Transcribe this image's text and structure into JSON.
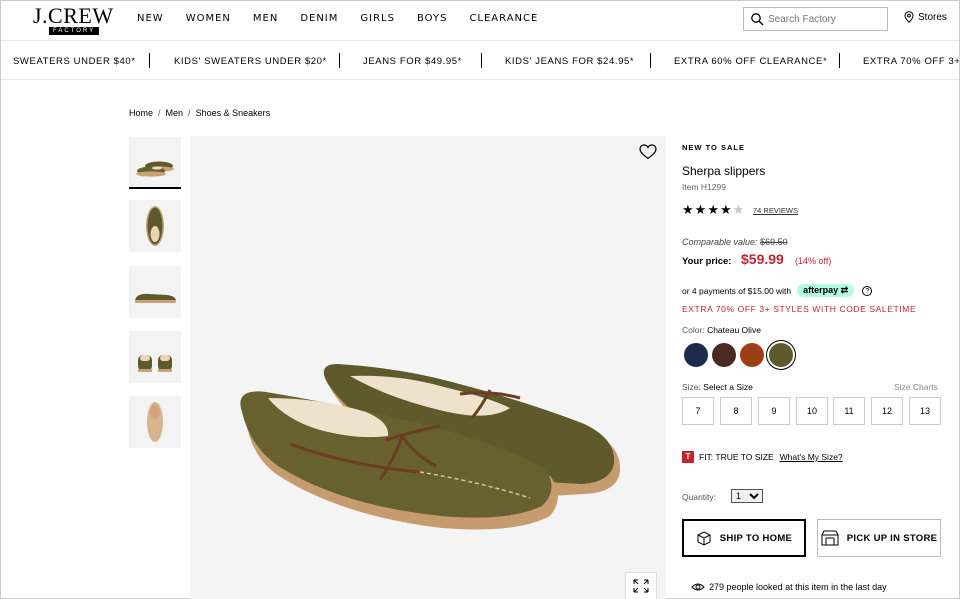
{
  "header": {
    "logo_main": "J.CREW",
    "logo_sub": "FACTORY",
    "nav": [
      "NEW",
      "WOMEN",
      "MEN",
      "DENIM",
      "GIRLS",
      "BOYS",
      "CLEARANCE"
    ],
    "search_placeholder": "Search Factory",
    "stores_label": "Stores"
  },
  "promo": [
    "SWEATERS UNDER $40*",
    "KIDS' SWEATERS UNDER $20*",
    "JEANS FOR $49.95*",
    "KIDS' JEANS FOR $24.95*",
    "EXTRA 60% OFF CLEARANCE*",
    "EXTRA 70% OFF 3+"
  ],
  "breadcrumb": [
    "Home",
    "Men",
    "Shoes & Sneakers"
  ],
  "product": {
    "badge": "NEW TO SALE",
    "title": "Sherpa slippers",
    "item": "Item H1299",
    "rating": 4,
    "reviews": "74 REVIEWS",
    "comparable_label": "Comparable value:",
    "comparable_value": "$69.50",
    "your_price_label": "Your price:",
    "price": "$59.99",
    "percent_off": "(14% off)",
    "afterpay_text": "or 4 payments of $15.00 with",
    "afterpay_brand": "afterpay",
    "promo_code": "EXTRA 70% OFF 3+ STYLES WITH CODE SALETIME",
    "color_key": "Color:",
    "color_value": "Chateau Olive",
    "swatches": [
      "#1c2b49",
      "#4a2b24",
      "#9b3f15",
      "#5f5a2c"
    ],
    "size_key": "Size:",
    "size_value": "Select a Size",
    "size_charts": "Size Charts",
    "sizes": [
      "7",
      "8",
      "9",
      "10",
      "11",
      "12",
      "13"
    ],
    "fit_icon": "T",
    "fit_text": "FIT: TRUE TO SIZE",
    "fit_link": "What's My Size?",
    "quantity_label": "Quantity:",
    "quantity_value": "1",
    "ship_button": "SHIP TO HOME",
    "pickup_button": "PICK UP IN STORE",
    "viewers": "279 people looked at this item in the last day"
  },
  "colors": {
    "sale_red": "#c3242d",
    "afterpay_mint": "#b2fce4",
    "slipper_olive": "#5f5a2c"
  }
}
